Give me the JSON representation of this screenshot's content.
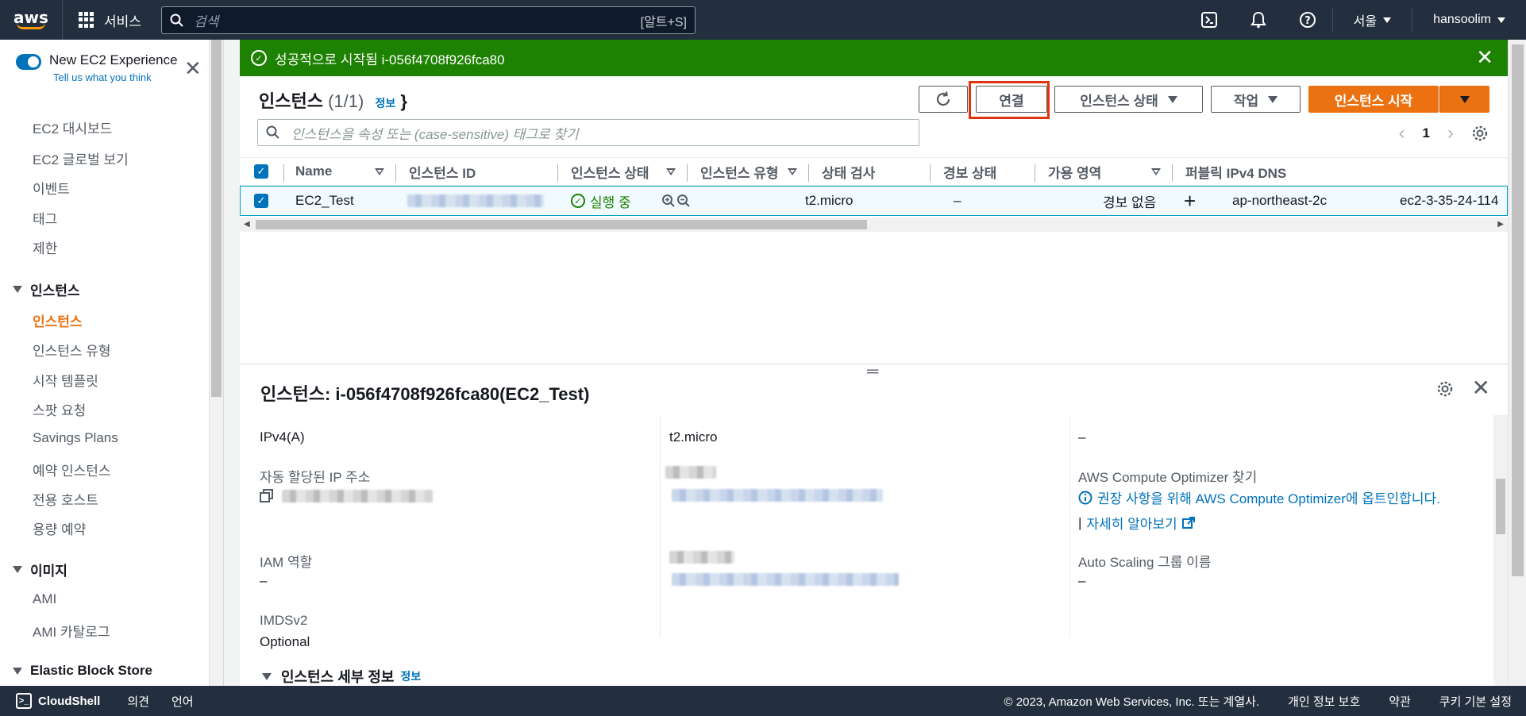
{
  "nav": {
    "logo": "aws",
    "services": "서비스",
    "search_placeholder": "검색",
    "search_shortcut": "[알트+S]",
    "region": "서울",
    "user": "hansoolim"
  },
  "sidebar": {
    "toggle_title": "New EC2 Experience",
    "toggle_sub": "Tell us what you think",
    "top_items": [
      "EC2 대시보드",
      "EC2 글로벌 보기",
      "이벤트",
      "태그",
      "제한"
    ],
    "sections": [
      {
        "title": "인스턴스",
        "items": [
          "인스턴스",
          "인스턴스 유형",
          "시작 템플릿",
          "스팟 요청",
          "Savings Plans",
          "예약 인스턴스",
          "전용 호스트",
          "용량 예약"
        ]
      },
      {
        "title": "이미지",
        "items": [
          "AMI",
          "AMI 카탈로그"
        ]
      },
      {
        "title": "Elastic Block Store",
        "items": []
      }
    ],
    "active": "인스턴스"
  },
  "banner": {
    "message": "성공적으로 시작됨 i-056f4708f926fca80"
  },
  "instances": {
    "title": "인스턴스",
    "count": "(1/1)",
    "info": "정보",
    "buttons": {
      "connect": "연결",
      "state": "인스턴스 상태",
      "actions": "작업",
      "launch": "인스턴스 시작"
    },
    "filter_placeholder": "인스턴스을 속성 또는 (case-sensitive) 태그로 찾기",
    "page": "1",
    "columns": [
      "Name",
      "인스턴스 ID",
      "인스턴스 상태",
      "인스턴스 유형",
      "상태 검사",
      "경보 상태",
      "가용 영역",
      "퍼블릭 IPv4 DNS"
    ],
    "rows": [
      {
        "name": "EC2_Test",
        "state": "실행 중",
        "type": "t2.micro",
        "check": "–",
        "alarm": "경보 없음",
        "az": "ap-northeast-2c",
        "dns": "ec2-3-35-24-114"
      }
    ]
  },
  "detail": {
    "title": "인스턴스: i-056f4708f926fca80(EC2_Test)",
    "col1": {
      "v1": "IPv4(A)",
      "label2": "자동 할당된 IP 주소",
      "label3": "IAM 역할",
      "v3": "–",
      "label4": "IMDSv2",
      "v4": "Optional"
    },
    "col2": {
      "v1": "t2.micro"
    },
    "col3": {
      "v1": "–",
      "label2": "AWS Compute Optimizer 찾기",
      "opt_text_1": "권장 사항을 위해 ",
      "opt_link": "AWS Compute Optimizer",
      "opt_text_2": "에 옵트인합니다.",
      "learn_more": "자세히 알아보기",
      "label3": "Auto Scaling 그룹 이름",
      "v3": "–"
    },
    "subsection": "인스턴스 세부 정보",
    "subsection_info": "정보"
  },
  "footer": {
    "cloudshell": "CloudShell",
    "feedback": "의견",
    "language": "언어",
    "copyright": "© 2023, Amazon Web Services, Inc. 또는 계열사.",
    "privacy": "개인 정보 보호",
    "terms": "약관",
    "cookies": "쿠키 기본 설정"
  }
}
